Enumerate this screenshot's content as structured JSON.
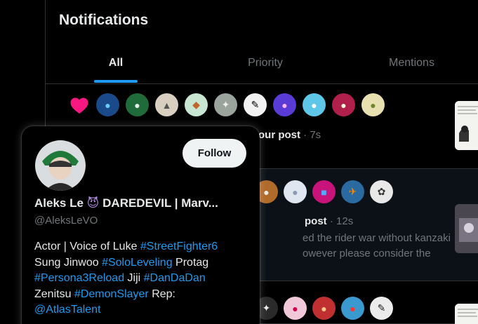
{
  "header": {
    "title": "Notifications"
  },
  "tabs": [
    {
      "label": "All",
      "active": true
    },
    {
      "label": "Priority",
      "active": false
    },
    {
      "label": "Mentions",
      "active": false
    }
  ],
  "notifications": [
    {
      "icon": "heart-icon",
      "text": "our post",
      "time": "· 7s"
    },
    {
      "text": "post",
      "time": "· 12s",
      "body": "ed the rider war without kanzaki owever please consider the"
    },
    {
      "text": ""
    }
  ],
  "hover_card": {
    "follow_label": "Follow",
    "display_name": "Aleks Le",
    "display_name_emoji": "😈",
    "display_name_rest": "DAREDEVIL | Marv...",
    "handle": "@AleksLeVO",
    "bio": {
      "t1": "Actor | Voice of Luke ",
      "l1": "#StreetFighter6",
      "t2": "Sung Jinwoo ",
      "l2": "#SoloLeveling",
      "t3": " Protag",
      "l3": "#Persona3Reload",
      "t4": " Jiji ",
      "l4": "#DanDaDan",
      "t5": "Zenitsu ",
      "l5": "#DemonSlayer",
      "t6": " Rep:",
      "l6": "@AtlasTalent"
    }
  },
  "colors": {
    "accent": "#1d9bf0",
    "heart": "#f91880",
    "border": "#2f3336",
    "muted": "#71767b"
  }
}
